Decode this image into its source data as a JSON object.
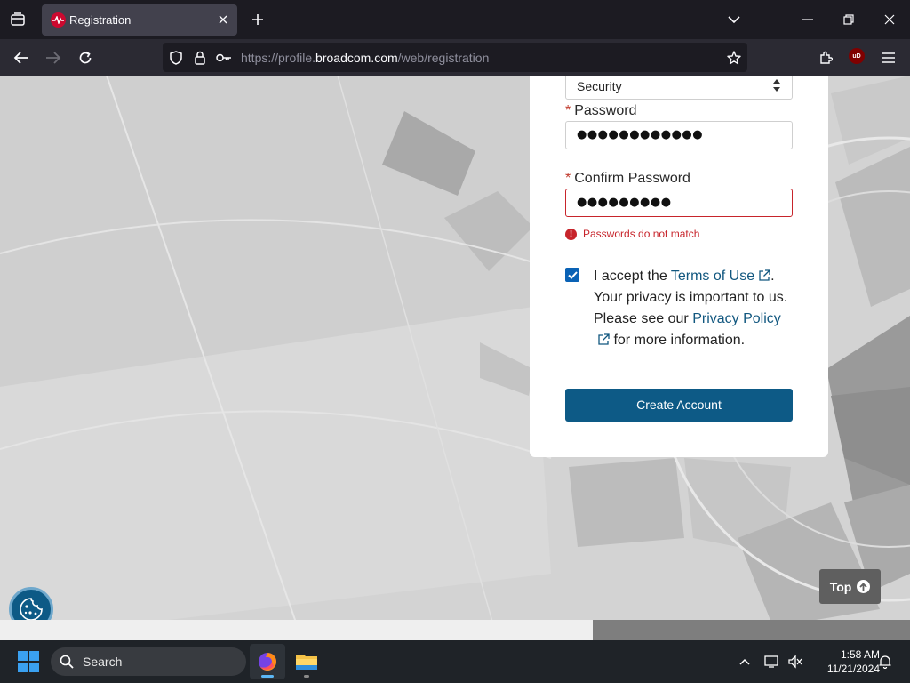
{
  "browser": {
    "tab": {
      "title": "Registration"
    },
    "url": {
      "prefix": "https://profile.",
      "host": "broadcom.com",
      "path": "/web/registration"
    },
    "extension": {
      "label": "uD"
    }
  },
  "form": {
    "security_select": {
      "value": "Security"
    },
    "password": {
      "required_mark": "*",
      "label": "Password",
      "masked_value": "●●●●●●●●●●●●"
    },
    "confirm_password": {
      "required_mark": "*",
      "label": "Confirm Password",
      "masked_value": "●●●●●●●●●"
    },
    "error": {
      "icon": "!",
      "message": "Passwords do not match"
    },
    "terms": {
      "checked": true,
      "text_1": "I accept the ",
      "terms_link": "Terms of Use",
      "text_2": ". Your privacy is important to us. Please see our ",
      "privacy_link": "Privacy Policy",
      "text_3": " for more information."
    },
    "submit_label": "Create Account"
  },
  "page_controls": {
    "top_label": "Top"
  },
  "taskbar": {
    "search_label": "Search",
    "time": "1:58 AM",
    "date": "11/21/2024"
  },
  "colors": {
    "brand_button": "#0d5a86",
    "error": "#c7242b",
    "link": "#11577f",
    "checkbox": "#0a62b5"
  }
}
